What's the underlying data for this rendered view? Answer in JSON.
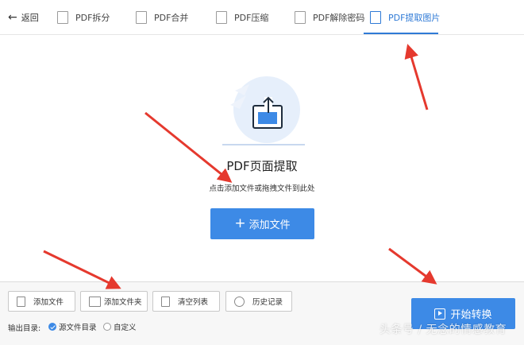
{
  "topbar": {
    "back_label": "返回",
    "tabs": [
      {
        "label": "PDF拆分",
        "icon": "split-icon",
        "active": false
      },
      {
        "label": "PDF合并",
        "icon": "merge-icon",
        "active": false
      },
      {
        "label": "PDF压缩",
        "icon": "compress-icon",
        "active": false
      },
      {
        "label": "PDF解除密码",
        "icon": "unlock-icon",
        "active": false
      },
      {
        "label": "PDF提取图片",
        "icon": "extract-image-icon",
        "active": true
      }
    ]
  },
  "main": {
    "title": "PDF页面提取",
    "subtitle": "点击添加文件或拖拽文件到此处",
    "add_file_button": "添加文件"
  },
  "toolbar": {
    "add_file": "添加文件",
    "add_folder": "添加文件夹",
    "clear_list": "清空列表",
    "history": "历史记录"
  },
  "output": {
    "label": "输出目录:",
    "options": [
      {
        "label": "源文件目录",
        "selected": true
      },
      {
        "label": "自定义",
        "selected": false
      }
    ]
  },
  "start_button": "开始转换",
  "watermark": "头条号 / 无念的情感教育",
  "colors": {
    "accent": "#3d8ae6",
    "active_tab": "#2f7ad6",
    "arrow": "#e5392e"
  }
}
